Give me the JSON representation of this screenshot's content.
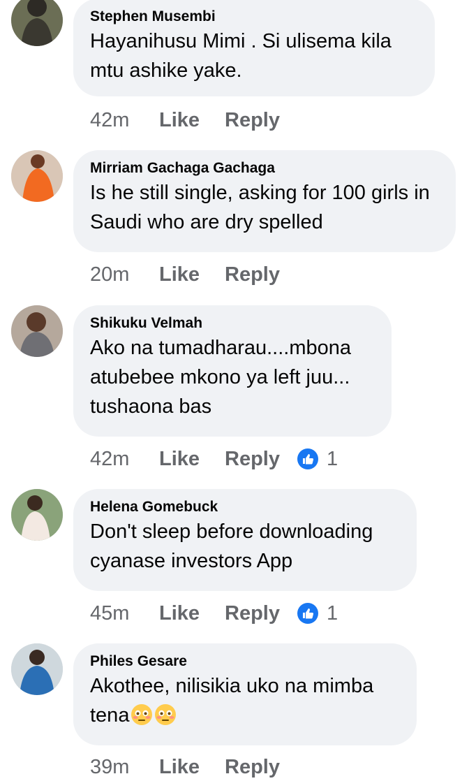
{
  "comments": [
    {
      "author": "Stephen Musembi",
      "text": "Hayanihusu Mimi . Si ulisema kila mtu ashike yake.",
      "time": "42m",
      "like_label": "Like",
      "reply_label": "Reply",
      "reactions": null
    },
    {
      "author": "Mirriam Gachaga Gachaga",
      "text": "Is he still single, asking for 100 girls in Saudi who are dry spelled",
      "time": "20m",
      "like_label": "Like",
      "reply_label": "Reply",
      "reactions": null
    },
    {
      "author": "Shikuku Velmah",
      "text": "Ako na tumadharau....mbona atubebee mkono ya left juu... tushaona bas",
      "time": "42m",
      "like_label": "Like",
      "reply_label": "Reply",
      "reactions": "1"
    },
    {
      "author": "Helena Gomebuck",
      "text": "Don't sleep before downloading cyanase investors App",
      "time": "45m",
      "like_label": "Like",
      "reply_label": "Reply",
      "reactions": "1"
    },
    {
      "author": "Philes Gesare",
      "text": "Akothee, nilisikia uko na mimba tena",
      "emoji": [
        "flushed-face-emoji",
        "flushed-face-emoji"
      ],
      "time": "39m",
      "like_label": "Like",
      "reply_label": "Reply",
      "reactions": null
    }
  ],
  "colors": {
    "bubble": "#f0f2f5",
    "text": "#050505",
    "meta": "#65676b",
    "like_badge": "#1877f2"
  }
}
